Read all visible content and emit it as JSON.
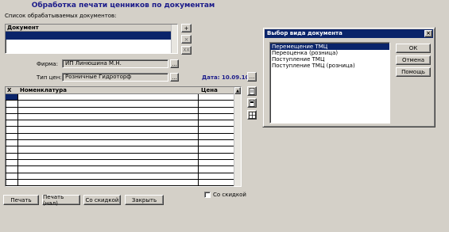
{
  "title": "Обработка печати ценников по документам",
  "doc_list_label": "Список обрабатываемых документов:",
  "doc_table": {
    "header": "Документ"
  },
  "side_buttons": {
    "add": "+",
    "remove": "×",
    "remove_all": "XX"
  },
  "firm": {
    "label": "Фирма:",
    "value": "ИП Линюшина М.Н.",
    "button": "..."
  },
  "price_type": {
    "label": "Тип цен:",
    "value": "Розничные Гидроторф",
    "button": "..."
  },
  "date": {
    "label": "Дата:",
    "value": "10.09.10",
    "button": "..."
  },
  "goods_table": {
    "col_x": "X",
    "col_name": "Номенклатура",
    "col_price": "Цена"
  },
  "discount_checkbox": {
    "label": "Со скидкой",
    "checked": false
  },
  "bottom_buttons": {
    "print": "Печать",
    "print_nal": "Печать (нал)",
    "with_discount": "Со скидкой",
    "close": "Закрыть"
  },
  "dialog": {
    "title": "Выбор вида документа",
    "close": "×",
    "items": [
      "Перемещение ТМЦ",
      "Переоценка (розница)",
      "Поступление ТМЦ",
      "Поступление ТМЦ (розница)"
    ],
    "selected_index": 0,
    "ok": "ОК",
    "cancel": "Отмена",
    "help": "Помощь"
  }
}
